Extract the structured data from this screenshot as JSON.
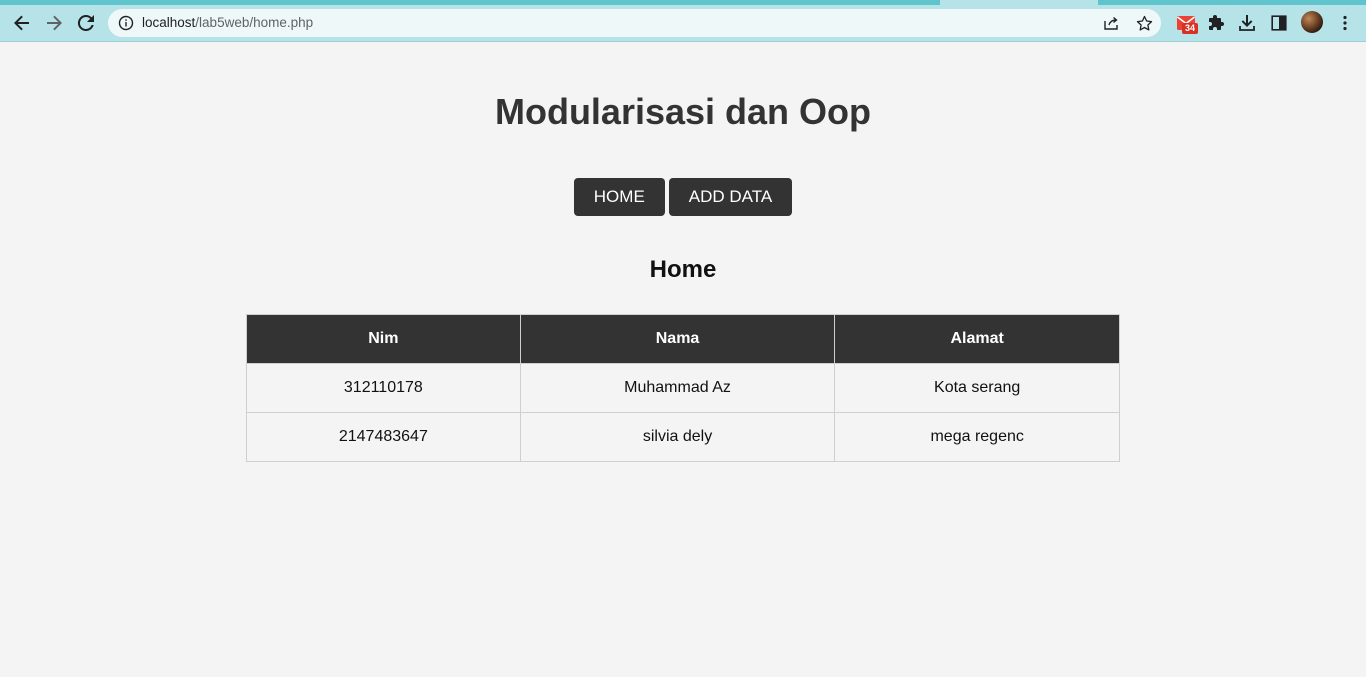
{
  "browser": {
    "url_host": "localhost",
    "url_path": "/lab5web/home.php",
    "mail_badge_count": "34",
    "icons": {
      "back": "arrow-left-icon",
      "forward": "arrow-right-icon",
      "reload": "reload-icon",
      "site_info": "info-icon",
      "share": "share-icon",
      "bookmark": "star-icon",
      "mail": "mail-icon",
      "extensions": "puzzle-icon",
      "downloads": "download-icon",
      "side_panel": "side-panel-icon",
      "menu": "kebab-menu-icon"
    },
    "colors": {
      "chrome": "#b6e3e8",
      "tab_accent": "#5fc4cc",
      "omnibox": "#eef8f9"
    }
  },
  "page": {
    "title": "Modularisasi dan Oop",
    "nav": [
      {
        "label": "HOME"
      },
      {
        "label": "ADD DATA"
      }
    ],
    "section_title": "Home",
    "table": {
      "headers": [
        "Nim",
        "Nama",
        "Alamat"
      ],
      "rows": [
        [
          "312110178",
          "Muhammad Az",
          "Kota serang"
        ],
        [
          "2147483647",
          "silvia dely",
          "mega regenc"
        ]
      ]
    },
    "colors": {
      "background": "#f4f4f4",
      "dark": "#333333"
    }
  }
}
